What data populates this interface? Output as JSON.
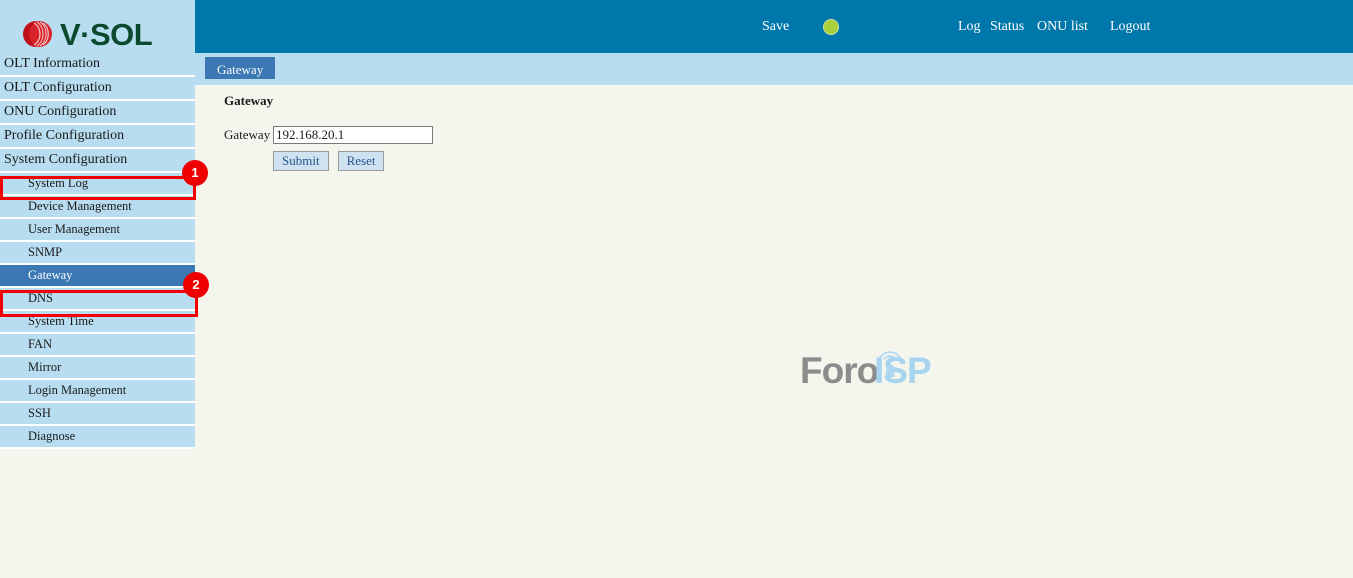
{
  "header": {
    "logo_text": "V·SOL",
    "logo_icon": "vsol-swirl-logo",
    "save_label": "Save",
    "save_indicator_color": "#a9cf3c",
    "links": [
      {
        "label": "Log"
      },
      {
        "label": "Status"
      },
      {
        "label": "ONU list"
      },
      {
        "label": "Logout"
      }
    ],
    "band_color": "#0077ab"
  },
  "tabs": [
    {
      "label": "Gateway",
      "active": true
    }
  ],
  "main": {
    "title": "Gateway",
    "form": {
      "field_label": "Gateway",
      "field_value": "192.168.20.1",
      "field_placeholder": "",
      "submit_label": "Submit",
      "reset_label": "Reset"
    },
    "watermark": {
      "text_primary": "Foro",
      "text_secondary": "ISP",
      "primary_color": "#8c8c8c",
      "secondary_color": "#a8d4ef",
      "icon": "antenna-tower-icon"
    }
  },
  "sidebar": {
    "items": [
      {
        "label": "OLT Information",
        "level": "main",
        "selected": false
      },
      {
        "label": "OLT Configuration",
        "level": "main",
        "selected": false
      },
      {
        "label": "ONU Configuration",
        "level": "main",
        "selected": false
      },
      {
        "label": "Profile Configuration",
        "level": "main",
        "selected": false
      },
      {
        "label": "System Configuration",
        "level": "main",
        "selected": false
      },
      {
        "label": "System Log",
        "level": "sub",
        "selected": false
      },
      {
        "label": "Device Management",
        "level": "sub",
        "selected": false
      },
      {
        "label": "User Management",
        "level": "sub",
        "selected": false
      },
      {
        "label": "SNMP",
        "level": "sub",
        "selected": false
      },
      {
        "label": "Gateway",
        "level": "sub",
        "selected": true
      },
      {
        "label": "DNS",
        "level": "sub",
        "selected": false
      },
      {
        "label": "System Time",
        "level": "sub",
        "selected": false
      },
      {
        "label": "FAN",
        "level": "sub",
        "selected": false
      },
      {
        "label": "Mirror",
        "level": "sub",
        "selected": false
      },
      {
        "label": "Login Management",
        "level": "sub",
        "selected": false
      },
      {
        "label": "SSH",
        "level": "sub",
        "selected": false
      },
      {
        "label": "Diagnose",
        "level": "sub",
        "selected": false
      }
    ]
  },
  "annotations": [
    {
      "number": "1",
      "target": "System Configuration",
      "color": "#ee0000"
    },
    {
      "number": "2",
      "target": "Gateway",
      "color": "#ee0000"
    }
  ]
}
